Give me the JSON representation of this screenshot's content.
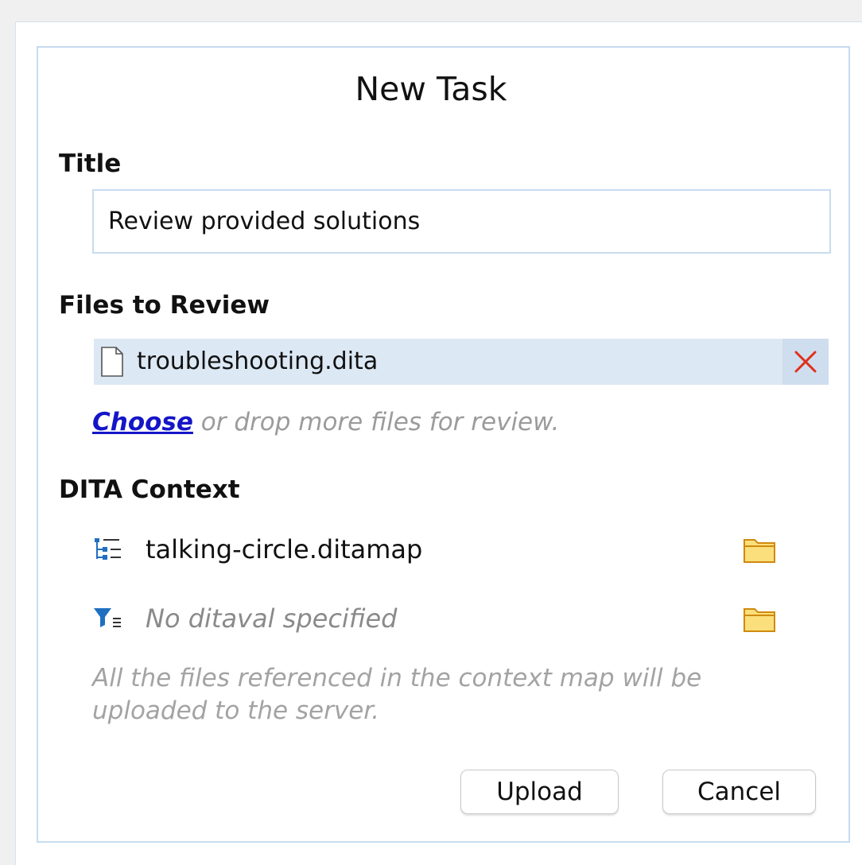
{
  "dialog": {
    "title": "New Task"
  },
  "title_section": {
    "heading": "Title",
    "value": "Review provided solutions"
  },
  "files_section": {
    "heading": "Files to Review",
    "files": [
      {
        "name": "troubleshooting.dita",
        "icon": "document-icon"
      }
    ],
    "remove_icon": "close-icon",
    "remove_color": "#e0301e",
    "choose_link": "Choose",
    "choose_suffix": " or drop more files for review."
  },
  "context_section": {
    "heading": "DITA Context",
    "map": {
      "label": "talking-circle.ditamap",
      "icon": "ditamap-icon",
      "browse_icon": "folder-icon"
    },
    "ditaval": {
      "label": "No ditaval specified",
      "icon": "filter-icon",
      "browse_icon": "folder-icon"
    },
    "note": "All the files referenced in the context map will be uploaded to the server."
  },
  "buttons": {
    "upload": "Upload",
    "cancel": "Cancel"
  },
  "colors": {
    "dialog_border": "#c6dcee",
    "selected_row": "#dce8f4",
    "link": "#1515c8",
    "folder": "#f0b323",
    "icon_blue": "#1f6fc0"
  }
}
